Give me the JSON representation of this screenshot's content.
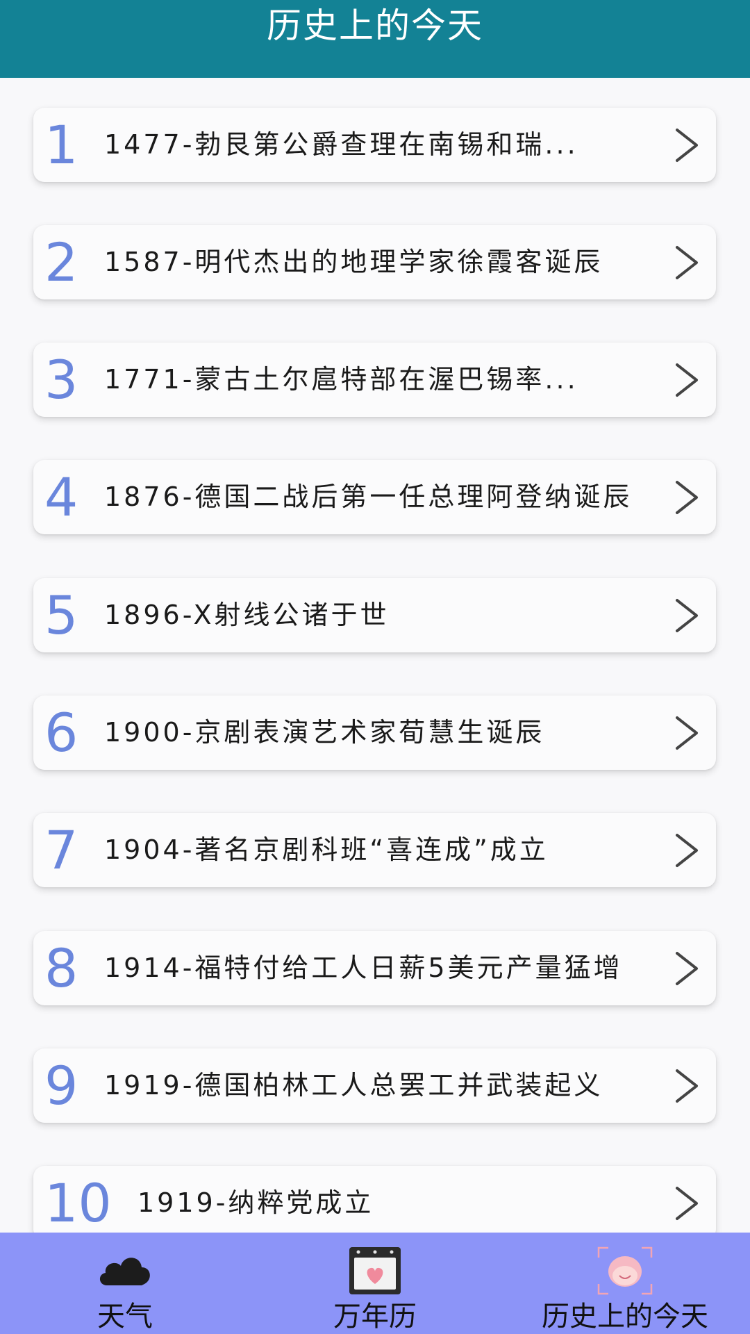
{
  "header": {
    "title": "历史上的今天"
  },
  "events": [
    {
      "index": "1",
      "text": "1477-勃艮第公爵查理在南锡和瑞..."
    },
    {
      "index": "2",
      "text": "1587-明代杰出的地理学家徐霞客诞辰"
    },
    {
      "index": "3",
      "text": "1771-蒙古土尔扈特部在渥巴锡率..."
    },
    {
      "index": "4",
      "text": "1876-德国二战后第一任总理阿登纳诞辰"
    },
    {
      "index": "5",
      "text": "1896-X射线公诸于世"
    },
    {
      "index": "6",
      "text": "1900-京剧表演艺术家荀慧生诞辰"
    },
    {
      "index": "7",
      "text": "1904-著名京剧科班“喜连成”成立"
    },
    {
      "index": "8",
      "text": "1914-福特付给工人日薪5美元产量猛增"
    },
    {
      "index": "9",
      "text": "1919-德国柏林工人总罢工并武装起义"
    },
    {
      "index": "10",
      "text": "1919-纳粹党成立"
    }
  ],
  "tabbar": {
    "tabs": [
      {
        "label": "天气",
        "icon": "cloud-icon"
      },
      {
        "label": "万年历",
        "icon": "calendar-icon"
      },
      {
        "label": "历史上的今天",
        "icon": "history-face-icon"
      }
    ]
  },
  "colors": {
    "header_bg": "#138295",
    "index_number": "#6a86dc",
    "tabbar_bg": "#8c94f8"
  }
}
